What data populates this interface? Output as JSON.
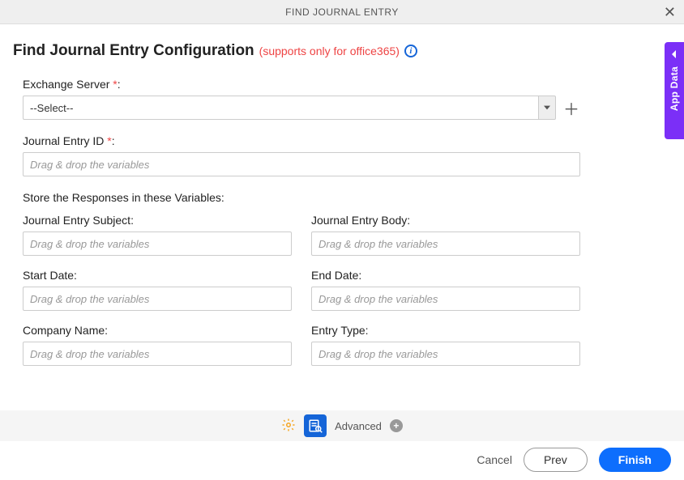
{
  "titlebar": {
    "title": "FIND JOURNAL ENTRY"
  },
  "heading": {
    "main": "Find Journal Entry Configuration",
    "note": "(supports only for office365)"
  },
  "form": {
    "exchange_server": {
      "label": "Exchange Server",
      "value": "--Select--"
    },
    "journal_entry_id": {
      "label": "Journal Entry ID",
      "placeholder": "Drag & drop the variables"
    },
    "store_section_label": "Store the Responses in these Variables:",
    "fields": {
      "subject": {
        "label": "Journal Entry Subject:",
        "placeholder": "Drag & drop the variables"
      },
      "body": {
        "label": "Journal Entry Body:",
        "placeholder": "Drag & drop the variables"
      },
      "start": {
        "label": "Start Date:",
        "placeholder": "Drag & drop the variables"
      },
      "end": {
        "label": "End Date:",
        "placeholder": "Drag & drop the variables"
      },
      "company": {
        "label": "Company Name:",
        "placeholder": "Drag & drop the variables"
      },
      "etype": {
        "label": "Entry Type:",
        "placeholder": "Drag & drop the variables"
      }
    }
  },
  "sidetab": {
    "label": "App Data"
  },
  "footer": {
    "advanced": "Advanced"
  },
  "buttons": {
    "cancel": "Cancel",
    "prev": "Prev",
    "finish": "Finish"
  },
  "required_mark": " *"
}
